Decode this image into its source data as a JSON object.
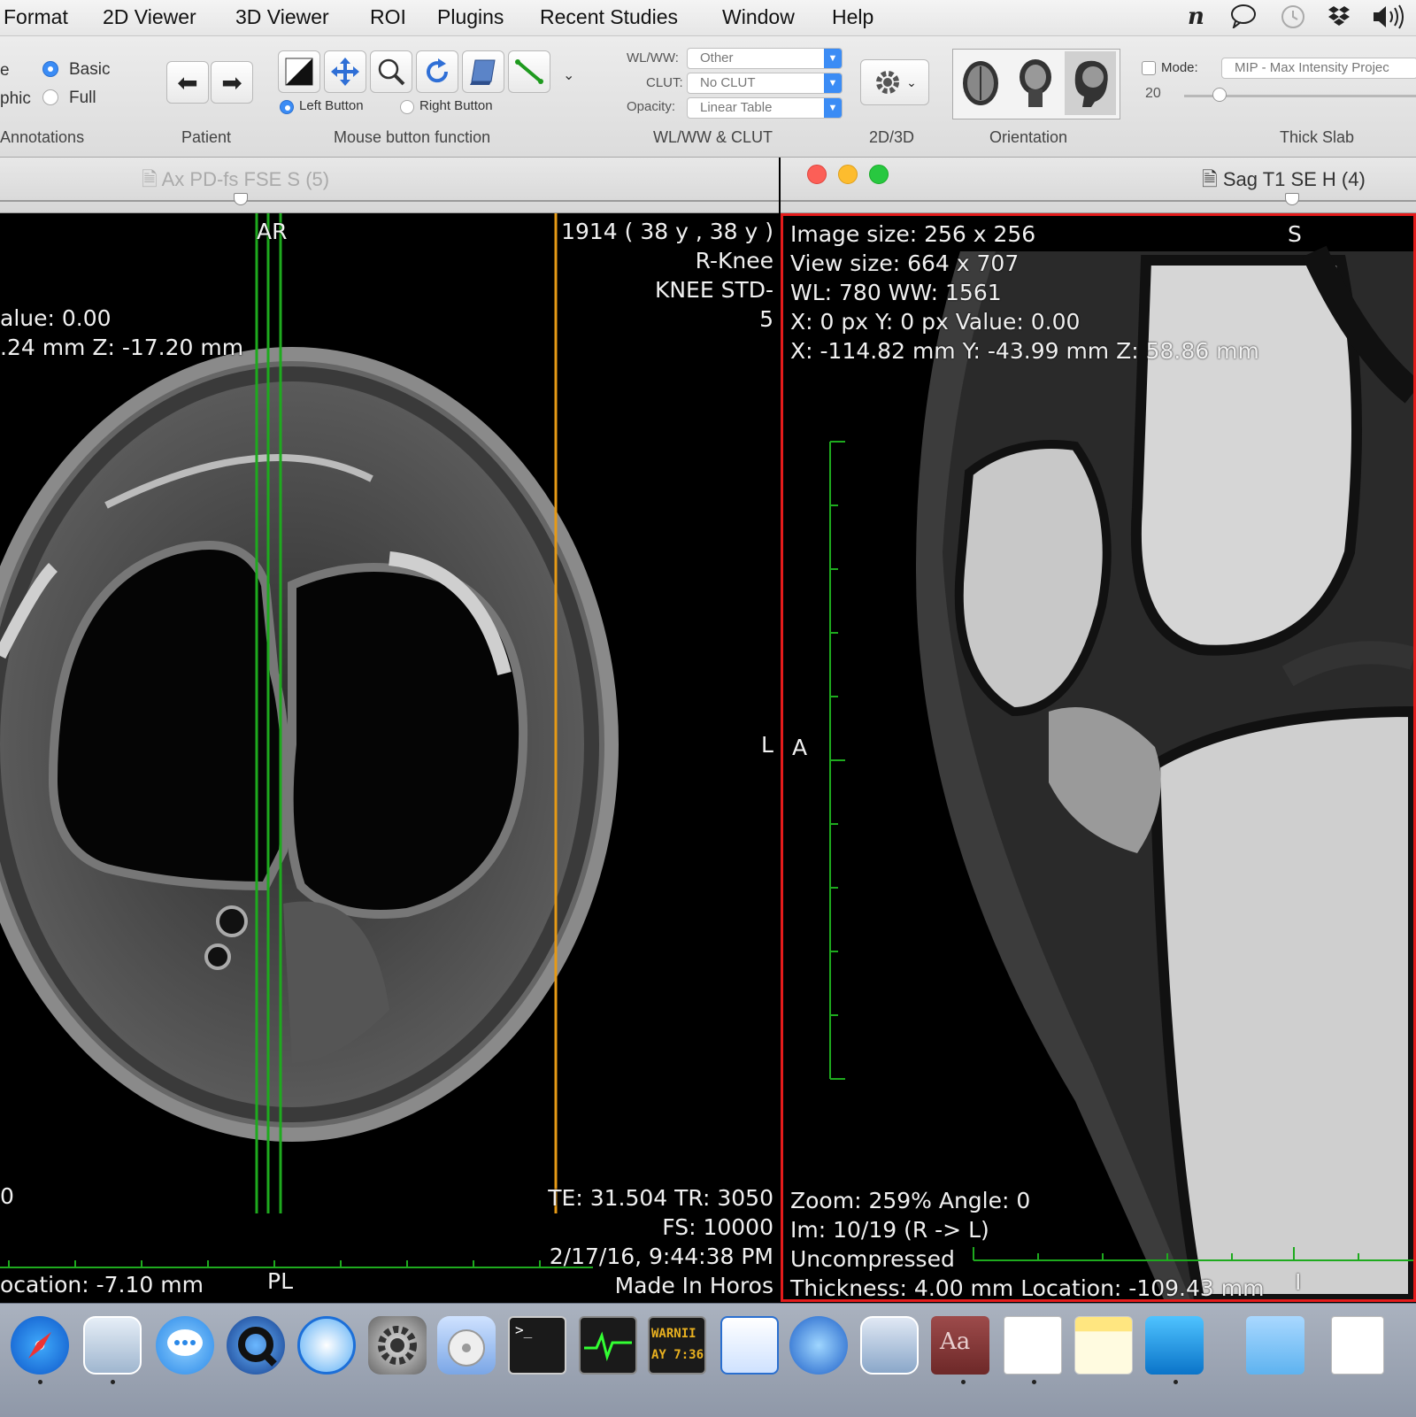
{
  "menu": {
    "items": [
      "Format",
      "2D Viewer",
      "3D Viewer",
      "ROI",
      "Plugins",
      "Recent Studies",
      "Window",
      "Help"
    ],
    "status_icons": [
      "n-icon",
      "messages-icon",
      "time-machine-icon",
      "dropbox-icon",
      "volume-icon"
    ]
  },
  "toolbar": {
    "annotations": {
      "partial_top": "e",
      "partial_bottom": "phic",
      "basic": "Basic",
      "full": "Full",
      "label": "Annotations"
    },
    "patient": {
      "label": "Patient"
    },
    "mouse": {
      "left": "Left Button",
      "right": "Right Button",
      "label": "Mouse button function"
    },
    "wlww": {
      "wl_label": "WL/WW:",
      "wl_value": "Other",
      "clut_label": "CLUT:",
      "clut_value": "No CLUT",
      "opacity_label": "Opacity:",
      "opacity_value": "Linear Table",
      "label": "WL/WW & CLUT"
    },
    "view2d3d": {
      "label": "2D/3D"
    },
    "orientation": {
      "label": "Orientation"
    },
    "thickslab": {
      "mode_label": "Mode:",
      "mode_value": "MIP - Max Intensity Projec",
      "value": "20",
      "label": "Thick Slab"
    }
  },
  "left_viewer": {
    "title": "Ax PD-fs FSE S (5)",
    "top_marker": "AR",
    "bottom_marker": "PL",
    "right_marker": "L",
    "top_right": [
      "1914 (  38 y ,  38 y )",
      "R-Knee",
      "KNEE STD-",
      "5"
    ],
    "top_left": [
      "alue: 0.00",
      ".24 mm Z: -17.20 mm"
    ],
    "bottom_left_zero": "0",
    "bottom_left": "ocation: -7.10 mm",
    "bottom_right": [
      "TE:  31.504 TR:  3050",
      "FS:  10000",
      "2/17/16, 9:44:38 PM",
      "Made In Horos"
    ]
  },
  "right_viewer": {
    "title": "Sag T1 SE H (4)",
    "top_marker": "S",
    "bottom_marker": "I",
    "left_marker": "A",
    "top_left": [
      "Image size: 256 x 256",
      "View size: 664 x 707",
      "WL: 780 WW: 1561",
      "X: 0 px Y: 0 px Value: 0.00",
      "X: -114.82 mm Y: -43.99 mm Z: 58.86 mm"
    ],
    "bottom_left": [
      "Zoom: 259% Angle: 0",
      "Im: 10/19  (R -> L)",
      "Uncompressed",
      "Thickness: 4.00 mm Location: -109.43 mm"
    ]
  },
  "dock": {
    "items": [
      "safari-icon",
      "preview-icon",
      "messages-icon",
      "quicktime-icon",
      "quicktime-player-icon",
      "system-preferences-icon",
      "dvd-player-icon",
      "terminal-icon",
      "activity-monitor-icon",
      "console-icon",
      "horos-icon",
      "network-utility-icon",
      "photos-icon",
      "dictionary-icon",
      "textedit-icon",
      "notes-icon",
      "horos-viewer-icon",
      "downloads-folder-icon",
      "document-icon"
    ],
    "console_text": [
      "WARNII",
      "AY 7:36"
    ]
  },
  "colors": {
    "accent": "#3b8cf5",
    "selection_border": "#e41b1b",
    "crosshair_green": "#1eaa1e",
    "crosshair_orange": "#e69a16"
  }
}
